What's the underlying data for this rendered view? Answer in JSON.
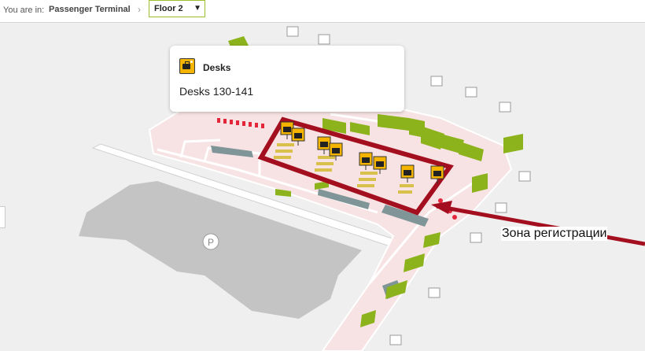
{
  "breadcrumb": {
    "label": "You are in:",
    "location": "Passenger Terminal",
    "separator": "›"
  },
  "floor_select": {
    "value": "Floor 2"
  },
  "popup": {
    "icon": "checkin-desk-icon",
    "title": "Desks",
    "body": "Desks 130-141"
  },
  "annotation": {
    "text": "Зона регистрации",
    "color": "#a30f1e"
  },
  "map": {
    "parking_label": "P",
    "colors": {
      "background": "#efefef",
      "parking": "#c4c4c4",
      "floor": "#f7e3e3",
      "walls": "#ffffff",
      "shops": "#8db31c",
      "highlight": "#a30f1e",
      "desk_marker": "#f5b400"
    }
  }
}
